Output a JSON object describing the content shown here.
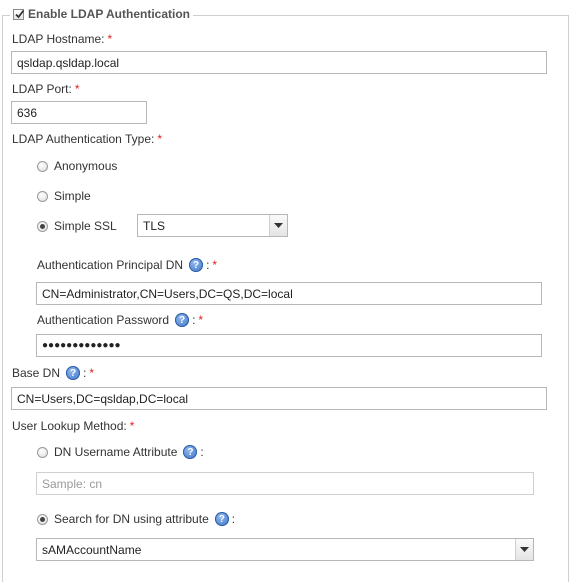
{
  "legend": {
    "label": "Enable LDAP Authentication",
    "checked": true
  },
  "hostname": {
    "label": "LDAP Hostname:",
    "value": "qsldap.qsldap.local"
  },
  "port": {
    "label": "LDAP Port:",
    "value": "636"
  },
  "auth_type": {
    "label": "LDAP Authentication Type:",
    "options": [
      "Anonymous",
      "Simple",
      "Simple SSL"
    ],
    "selected": "Simple SSL",
    "ssl_mode": "TLS"
  },
  "principal_dn": {
    "label": "Authentication Principal DN",
    "value": "CN=Administrator,CN=Users,DC=QS,DC=local"
  },
  "password": {
    "label": "Authentication Password",
    "value": "●●●●●●●●●●●●●"
  },
  "base_dn": {
    "label": "Base DN",
    "value": "CN=Users,DC=qsldap,DC=local"
  },
  "lookup": {
    "label": "User Lookup Method:",
    "dn_username_label": "DN Username Attribute",
    "dn_username_placeholder": "Sample: cn",
    "search_label": "Search for DN using attribute",
    "search_value": "sAMAccountName",
    "selected": "search"
  },
  "common": {
    "required": "*",
    "colon": ":"
  },
  "icons": {
    "help": "help-icon",
    "checkmark": "checkmark-icon",
    "dropdown": "chevron-down-icon"
  }
}
